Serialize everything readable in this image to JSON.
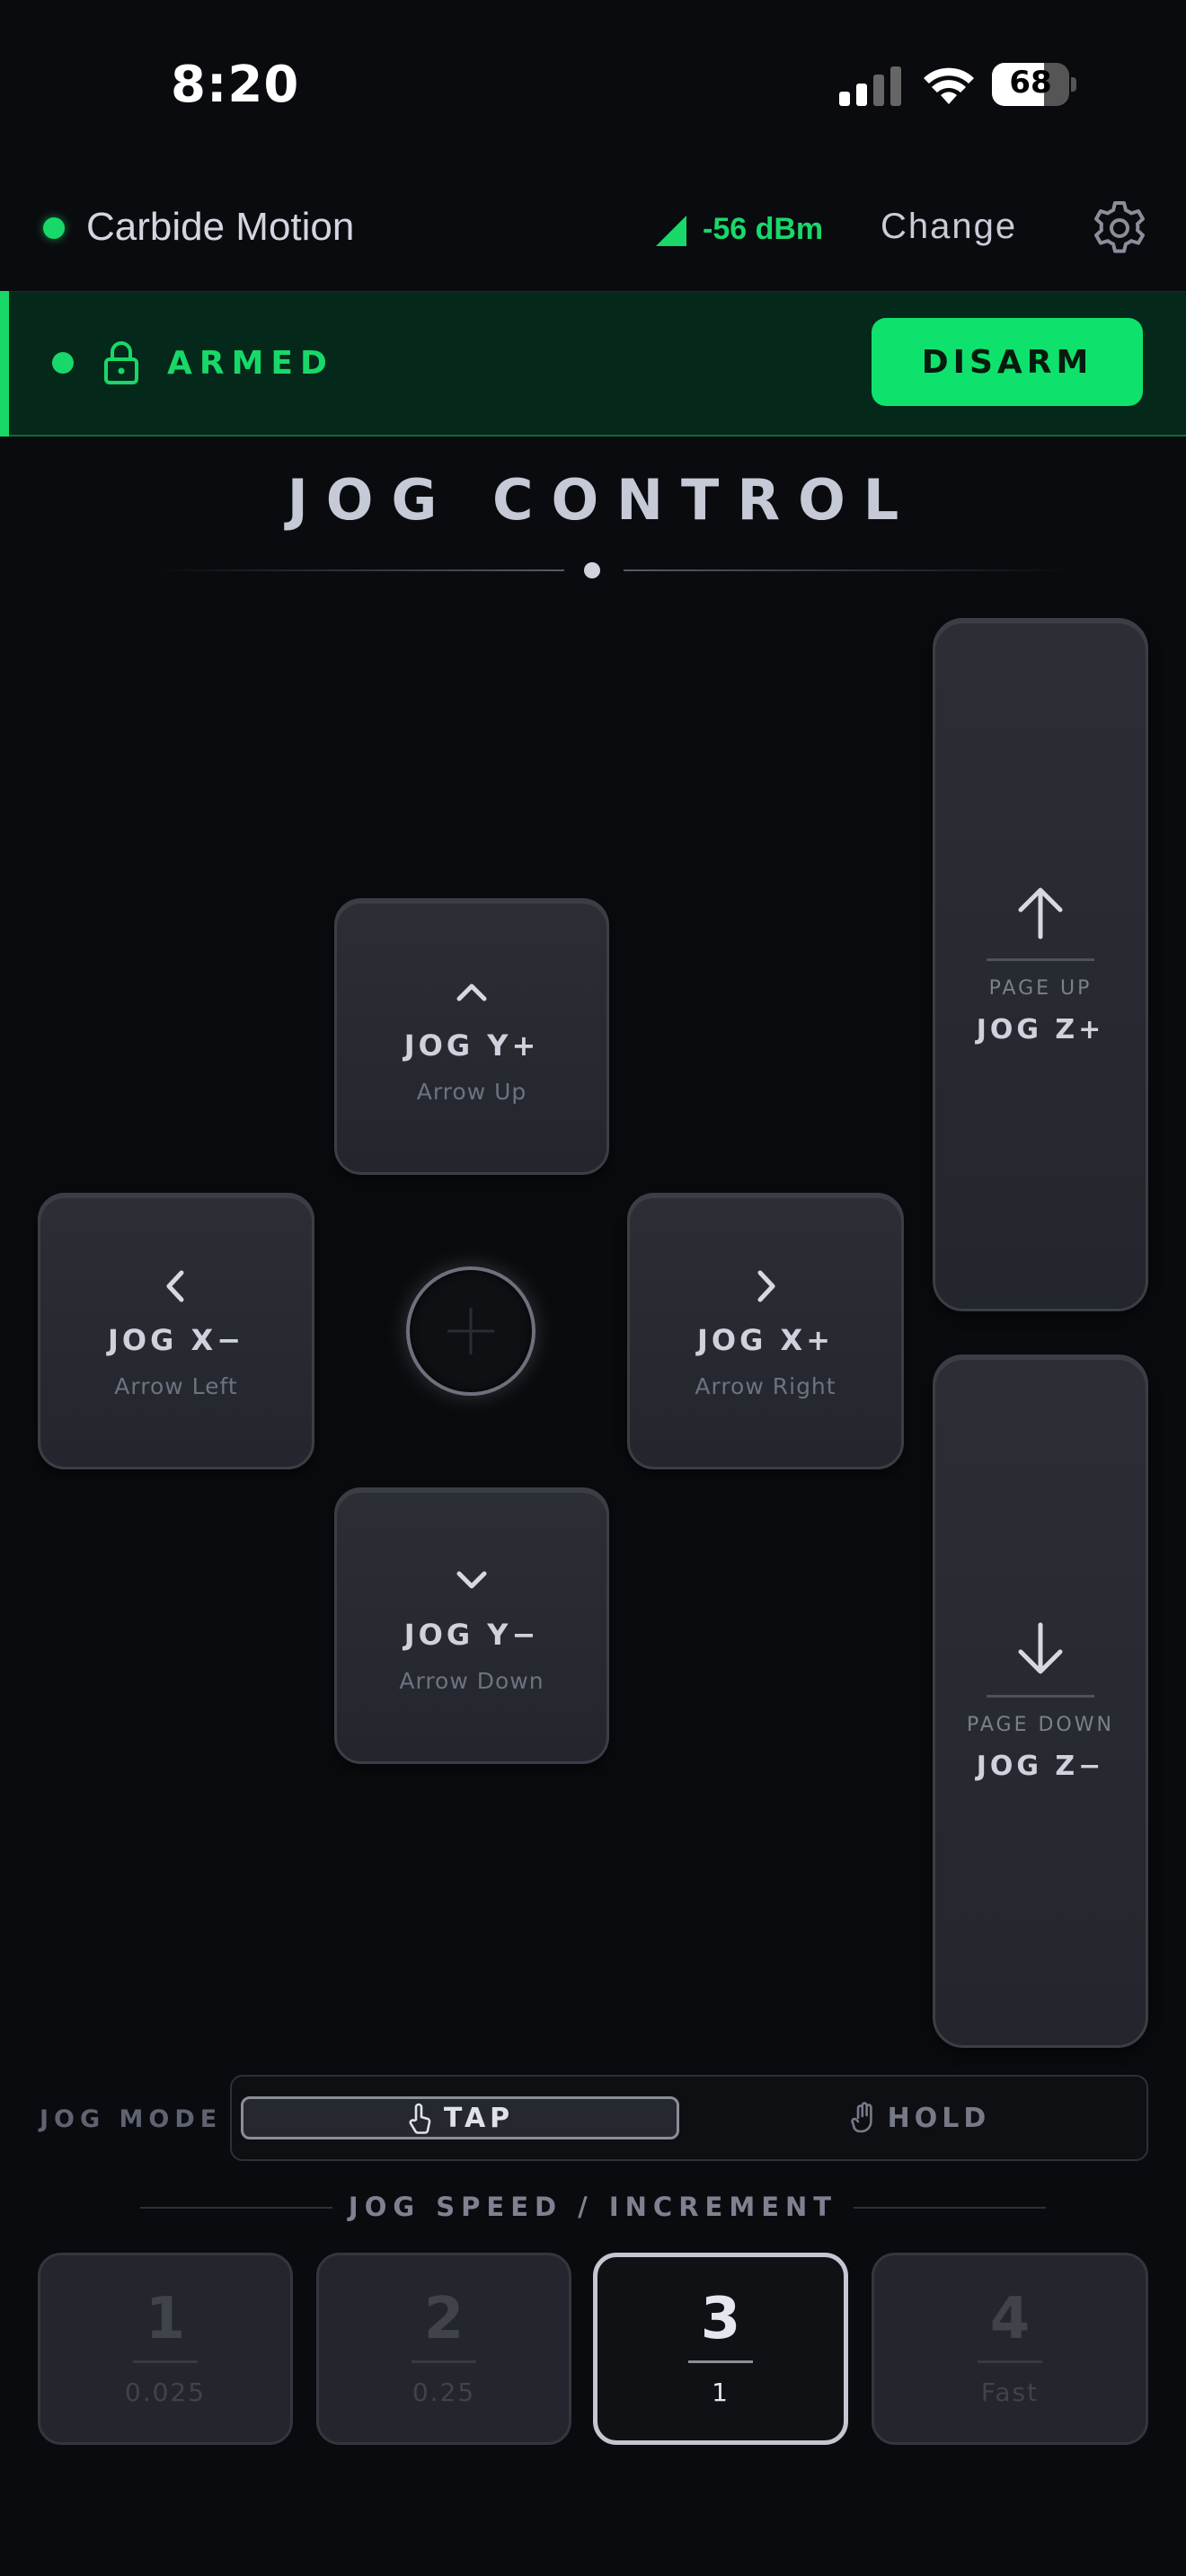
{
  "status_bar": {
    "time": "8:20",
    "battery": "68"
  },
  "connection": {
    "name": "Carbide Motion",
    "rssi": "-56 dBm",
    "change_label": "Change"
  },
  "arm": {
    "state": "ARMED",
    "button": "DISARM"
  },
  "title": "JOG CONTROL",
  "jog": {
    "y_plus": {
      "label": "JOG Y+",
      "key": "Arrow Up"
    },
    "x_minus": {
      "label": "JOG X−",
      "key": "Arrow Left"
    },
    "x_plus": {
      "label": "JOG X+",
      "key": "Arrow Right"
    },
    "y_minus": {
      "label": "JOG Y−",
      "key": "Arrow Down"
    },
    "z_plus": {
      "label": "JOG Z+",
      "key": "PAGE UP"
    },
    "z_minus": {
      "label": "JOG Z−",
      "key": "PAGE DOWN"
    }
  },
  "mode": {
    "label": "JOG MODE",
    "options": [
      "TAP",
      "HOLD"
    ],
    "selected": "TAP"
  },
  "speed": {
    "label": "JOG SPEED / INCREMENT",
    "options": [
      {
        "num": "1",
        "value": "0.025"
      },
      {
        "num": "2",
        "value": "0.25"
      },
      {
        "num": "3",
        "value": "1"
      },
      {
        "num": "4",
        "value": "Fast"
      }
    ],
    "selected": "3"
  },
  "colors": {
    "accent_green": "#18d86a",
    "disarm_button": "#0fe26c",
    "background": "#0a0b0e",
    "key": "#2a2c34"
  }
}
